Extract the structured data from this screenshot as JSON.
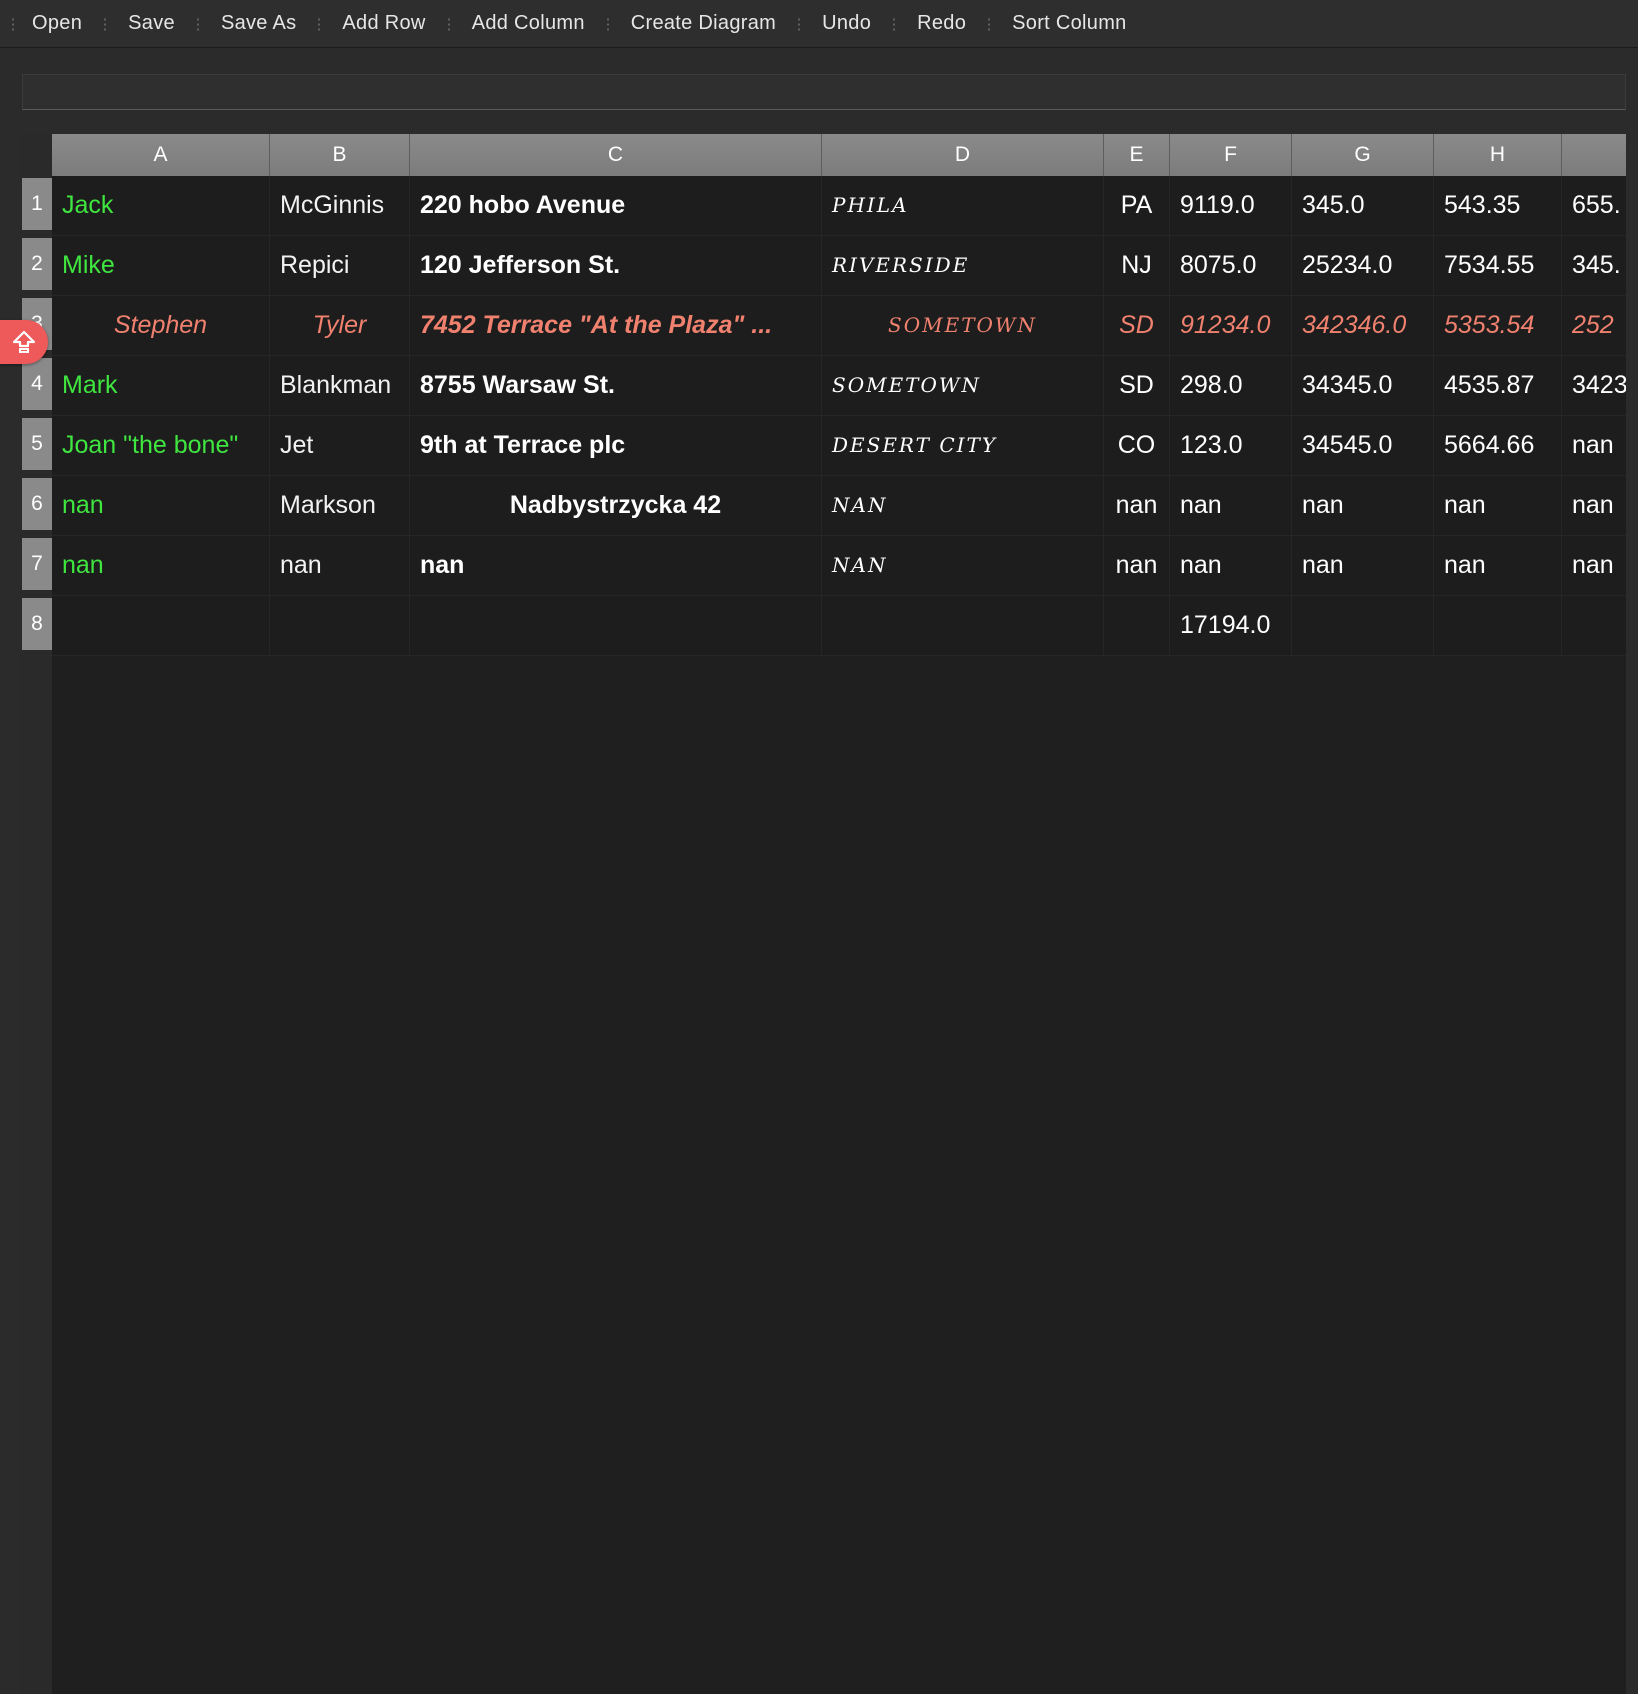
{
  "toolbar": {
    "buttons": [
      {
        "label": "Open"
      },
      {
        "label": "Save"
      },
      {
        "label": "Save As"
      },
      {
        "label": "Add Row"
      },
      {
        "label": "Add Column"
      },
      {
        "label": "Create Diagram"
      },
      {
        "label": "Undo"
      },
      {
        "label": "Redo"
      },
      {
        "label": "Sort Column"
      }
    ]
  },
  "edit_bar": {
    "value": ""
  },
  "colors": {
    "name_column": "#3fe63f",
    "selected_row": "#f0816f",
    "side_badge": "#ee5a5a",
    "header": "#858585",
    "background": "#1f1f1f"
  },
  "side_badge": {
    "icon": "upload-arrow-icon"
  },
  "sheet": {
    "columns": [
      "A",
      "B",
      "C",
      "D",
      "E",
      "F",
      "G",
      "H",
      ""
    ],
    "row_numbers": [
      "1",
      "2",
      "3",
      "4",
      "5",
      "6",
      "7",
      "8"
    ],
    "selected_row_index": 2,
    "rows": [
      [
        "Jack",
        "McGinnis",
        "220 hobo Avenue",
        "Phila",
        "PA",
        "9119.0",
        "345.0",
        "543.35",
        "655."
      ],
      [
        "Mike",
        "Repici",
        "120 Jefferson St.",
        "Riverside",
        "NJ",
        "8075.0",
        "25234.0",
        "7534.55",
        "345."
      ],
      [
        "Stephen",
        "Tyler",
        "7452 Terrace \"At the Plaza\" ...",
        "SomeTown",
        "SD",
        "91234.0",
        "342346.0",
        "5353.54",
        "252"
      ],
      [
        "Mark",
        "Blankman",
        "8755 Warsaw St.",
        "SomeTown",
        "SD",
        "298.0",
        "34345.0",
        "4535.87",
        "3423"
      ],
      [
        "Joan \"the bone\"",
        "Jet",
        "9th at Terrace plc",
        "Desert City",
        "CO",
        "123.0",
        "34545.0",
        "5664.66",
        "nan"
      ],
      [
        "nan",
        "Markson",
        "Nadbystrzycka 42",
        "nan",
        "nan",
        "nan",
        "nan",
        "nan",
        "nan"
      ],
      [
        "nan",
        "nan",
        "nan",
        "nan",
        "nan",
        "nan",
        "nan",
        "nan",
        "nan"
      ],
      [
        "",
        "",
        "",
        "",
        "",
        "17194.0",
        "",
        "",
        ""
      ]
    ]
  }
}
